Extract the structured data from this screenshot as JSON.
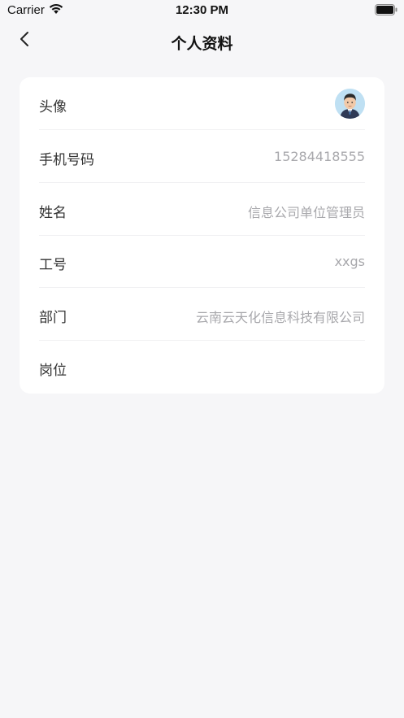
{
  "status_bar": {
    "carrier": "Carrier",
    "time": "12:30 PM",
    "wifi_icon": "wifi-icon",
    "battery_icon": "battery-icon"
  },
  "nav": {
    "title": "个人资料",
    "back_icon": "chevron-left-icon"
  },
  "profile": {
    "avatar": {
      "label": "头像",
      "icon": "avatar-image"
    },
    "phone": {
      "label": "手机号码",
      "value": "15284418555"
    },
    "name": {
      "label": "姓名",
      "value": "信息公司单位管理员"
    },
    "employee_id": {
      "label": "工号",
      "value": "xxgs"
    },
    "department": {
      "label": "部门",
      "value": "云南云天化信息科技有限公司"
    },
    "position": {
      "label": "岗位",
      "value": ""
    }
  },
  "colors": {
    "background": "#f6f6f8",
    "card": "#ffffff",
    "label": "#333333",
    "value": "#a8a8ac"
  }
}
